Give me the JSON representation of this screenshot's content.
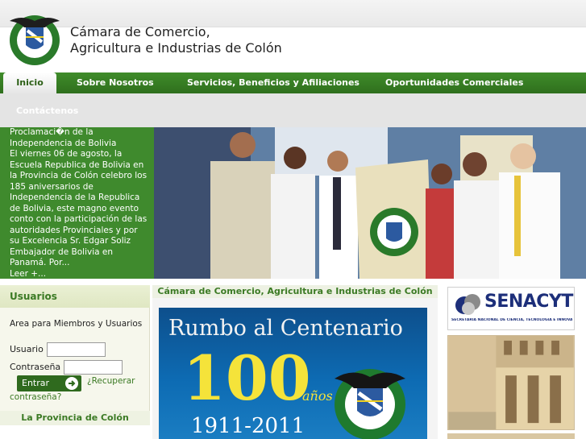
{
  "header": {
    "title_line1": "Cámara de Comercio,",
    "title_line2": "Agricultura e Industrias de Colón"
  },
  "nav": {
    "items": [
      {
        "label": "Inicio"
      },
      {
        "label": "Sobre Nosotros"
      },
      {
        "label": "Servicios, Beneficios y Afiliaciones"
      },
      {
        "label": "Oportunidades Comerciales"
      },
      {
        "label": "Contáctenos"
      }
    ]
  },
  "news": {
    "title": "Proclamaci�n de la Independencia de Bolivia",
    "body": "El viernes 06 de agosto, la Escuela Republica de Bolivia en la Provincia de Colón celebro los 185 aniversarios de Independencia de la Republica de Bolivia, este magno evento conto con la participación de las autoridades Provinciales y por su Excelencia Sr. Edgar Soliz Embajador de Bolivia en Panamá. Por...",
    "more": "Leer +..."
  },
  "users": {
    "heading": "Usuarios",
    "description": "Area para Miembros y Usuarios",
    "username_label": "Usuario",
    "username_value": "",
    "password_label": "Contraseña",
    "password_value": "",
    "enter_label": "Entrar",
    "recover_line1": "¿Recuperar",
    "recover_line2": "contraseña?"
  },
  "province": {
    "label": "La Provincia de Colón"
  },
  "center": {
    "heading": "Cámara de Comercio, Agricultura e Industrias de Colón",
    "banner_title": "Rumbo al Centenario",
    "banner_number": "100",
    "banner_suffix": "años",
    "banner_years": "1911-2011"
  },
  "sponsors": {
    "senacyt_name": "SENACYT",
    "senacyt_subtitle": "SECRETARIA NACIONAL DE CIENCIA, TECNOLOGIA E INNOVACION"
  },
  "colors": {
    "brand_green": "#3f8a2d",
    "nav_green": "#2f6f1d",
    "banner_blue": "#0d6bb3",
    "banner_yellow": "#f5e33a",
    "senacyt_blue": "#1d2f7a"
  },
  "icons": {
    "logo": "chamber-eagle-logo",
    "enter": "arrow-circle-icon",
    "senacyt": "senacyt-logo"
  }
}
